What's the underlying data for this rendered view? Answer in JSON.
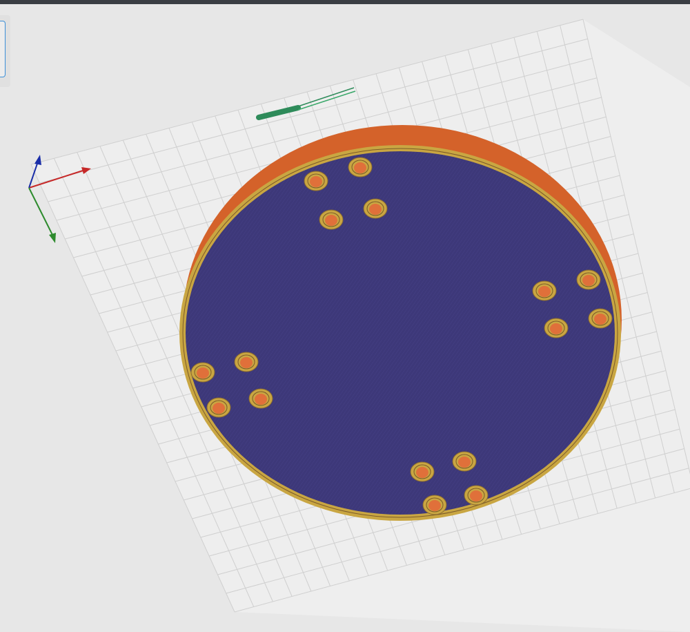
{
  "app": {
    "title": ""
  },
  "toolbar": {
    "active_tool_icon": "select-tool-icon"
  },
  "viewport": {
    "view": "3d-preview",
    "axis_colors": {
      "x": "#c62828",
      "y": "#2e8b2e",
      "z": "#1a2ea8"
    },
    "colors": {
      "bed_background": "#eeeeee",
      "grid_line": "#cfcfcf",
      "part_top": "#3d3879",
      "part_side": "#d4622a",
      "perimeter": "#c9a642",
      "hole_inner": "#e0703a",
      "tool_rod": "#2e8b5a"
    },
    "hole_count": 16
  }
}
